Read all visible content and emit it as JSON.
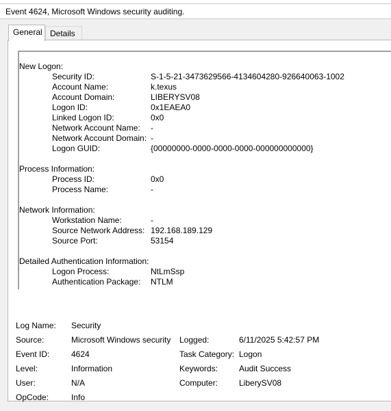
{
  "window": {
    "title": "Event 4624, Microsoft Windows security auditing."
  },
  "tabs": [
    {
      "label": "General",
      "active": true
    },
    {
      "label": "Details",
      "active": false
    }
  ],
  "description": {
    "sections": [
      {
        "heading": "New Logon:",
        "fields": [
          {
            "label": "Security ID:",
            "value": "S-1-5-21-3473629566-4134604280-926640063-1002"
          },
          {
            "label": "Account Name:",
            "value": "k.texus"
          },
          {
            "label": "Account Domain:",
            "value": "LIBERYSV08"
          },
          {
            "label": "Logon ID:",
            "value": "0x1EAEA0"
          },
          {
            "label": "Linked Logon ID:",
            "value": "0x0"
          },
          {
            "label": "Network Account Name:",
            "value": "-"
          },
          {
            "label": "Network Account Domain:",
            "value": "-"
          },
          {
            "label": "Logon GUID:",
            "value": "{00000000-0000-0000-0000-000000000000}"
          }
        ]
      },
      {
        "heading": "Process Information:",
        "fields": [
          {
            "label": "Process ID:",
            "value": "0x0"
          },
          {
            "label": "Process Name:",
            "value": "-"
          }
        ]
      },
      {
        "heading": "Network Information:",
        "fields": [
          {
            "label": "Workstation Name:",
            "value": "-"
          },
          {
            "label": "Source Network Address:",
            "value": "192.168.189.129"
          },
          {
            "label": "Source Port:",
            "value": "53154"
          }
        ]
      },
      {
        "heading": "Detailed Authentication Information:",
        "fields": [
          {
            "label": "Logon Process:",
            "value": "NtLmSsp"
          },
          {
            "label": "Authentication Package:",
            "value": "NTLM"
          }
        ]
      }
    ]
  },
  "properties": {
    "log_name_label": "Log Name:",
    "log_name": "Security",
    "source_label": "Source:",
    "source": "Microsoft Windows security",
    "logged_label": "Logged:",
    "logged": "6/11/2025 5:42:57 PM",
    "event_id_label": "Event ID:",
    "event_id": "4624",
    "task_category_label": "Task Category:",
    "task_category": "Logon",
    "level_label": "Level:",
    "level": "Information",
    "keywords_label": "Keywords:",
    "keywords": "Audit Success",
    "user_label": "User:",
    "user": "N/A",
    "computer_label": "Computer:",
    "computer": "LiberySV08",
    "opcode_label": "OpCode:",
    "opcode": "Info"
  }
}
